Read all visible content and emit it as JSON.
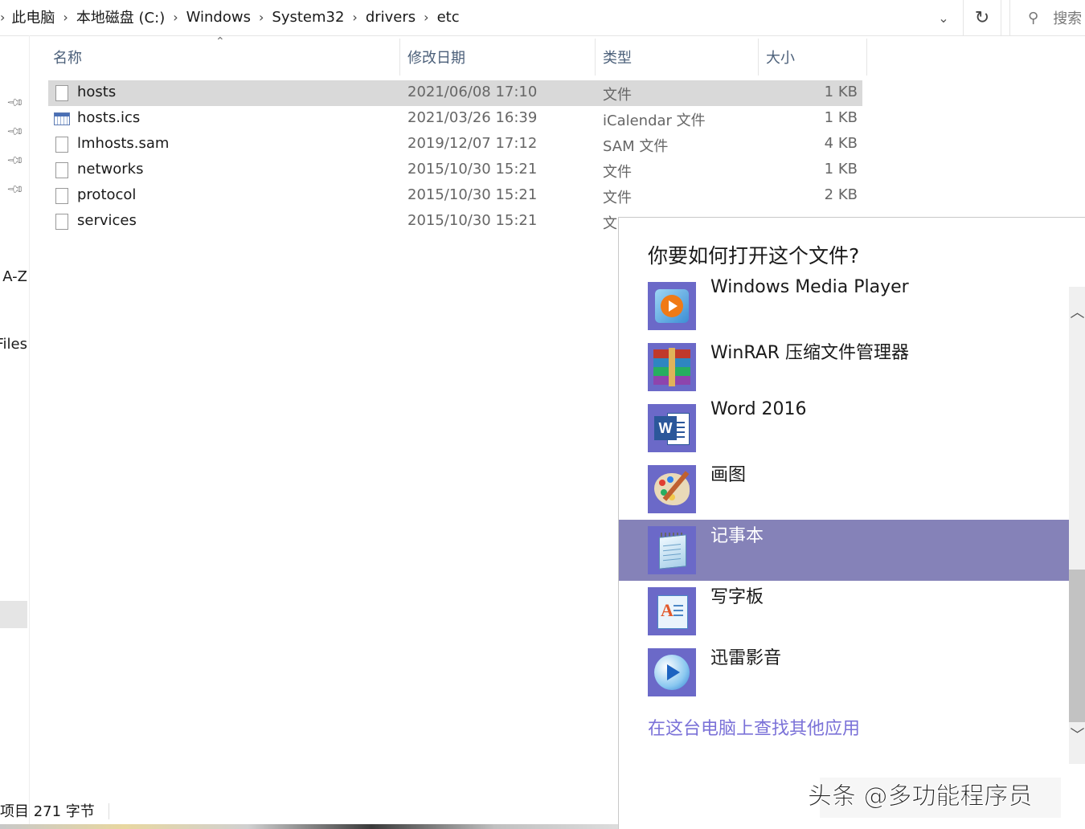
{
  "breadcrumb": {
    "items": [
      "此电脑",
      "本地磁盘 (C:)",
      "Windows",
      "System32",
      "drivers",
      "etc"
    ]
  },
  "search": {
    "placeholder": "搜索"
  },
  "nav": {
    "labels": [
      "A-Z",
      "Files"
    ]
  },
  "columns": {
    "name": "名称",
    "date": "修改日期",
    "type": "类型",
    "size": "大小"
  },
  "files": [
    {
      "name": "hosts",
      "date": "2021/06/08 17:10",
      "type": "文件",
      "size": "1 KB"
    },
    {
      "name": "hosts.ics",
      "date": "2021/03/26 16:39",
      "type": "iCalendar 文件",
      "size": "1 KB"
    },
    {
      "name": "lmhosts.sam",
      "date": "2019/12/07 17:12",
      "type": "SAM 文件",
      "size": "4 KB"
    },
    {
      "name": "networks",
      "date": "2015/10/30 15:21",
      "type": "文件",
      "size": "1 KB"
    },
    {
      "name": "protocol",
      "date": "2015/10/30 15:21",
      "type": "文件",
      "size": "2 KB"
    },
    {
      "name": "services",
      "date": "2015/10/30 15:21",
      "type": "文",
      "size": ""
    }
  ],
  "status": {
    "text": "项目 271 字节"
  },
  "dialog": {
    "title": "你要如何打开这个文件?",
    "apps": [
      {
        "name": "Windows Media Player",
        "icon": "windows-media-player-icon"
      },
      {
        "name": "WinRAR 压缩文件管理器",
        "icon": "winrar-icon"
      },
      {
        "name": "Word 2016",
        "icon": "word-icon"
      },
      {
        "name": "画图",
        "icon": "paint-icon"
      },
      {
        "name": "记事本",
        "icon": "notepad-icon"
      },
      {
        "name": "写字板",
        "icon": "wordpad-icon"
      },
      {
        "name": "迅雷影音",
        "icon": "xunlei-icon"
      }
    ],
    "selected_app": "记事本",
    "more_link": "在这台电脑上查找其他应用"
  },
  "watermark": {
    "text": "头条 @多功能程序员"
  },
  "colors": {
    "accent": "#6b69c8",
    "selected_row": "#8582b8",
    "link": "#7b72d8"
  }
}
